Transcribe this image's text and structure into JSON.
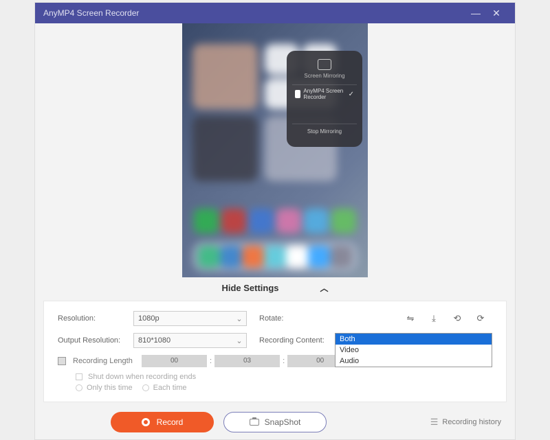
{
  "titlebar": {
    "title": "AnyMP4 Screen Recorder"
  },
  "mirror": {
    "title": "Screen Mirroring",
    "item": "AnyMP4 Screen Recorder",
    "stop": "Stop Mirroring"
  },
  "hide": {
    "label": "Hide Settings"
  },
  "settings": {
    "resolution": {
      "label": "Resolution:",
      "value": "1080p"
    },
    "output": {
      "label": "Output Resolution:",
      "value": "810*1080"
    },
    "rotate": {
      "label": "Rotate:"
    },
    "recording_content": {
      "label": "Recording Content:",
      "selected": "Both",
      "options": [
        "Both",
        "Video",
        "Audio"
      ]
    },
    "length": {
      "label": "Recording Length",
      "h": "00",
      "m": "03",
      "s": "00"
    },
    "shutdown": "Shut down when recording ends",
    "only_this": "Only this time",
    "each_time": "Each time"
  },
  "buttons": {
    "record": "Record",
    "snapshot": "SnapShot",
    "history": "Recording history"
  }
}
